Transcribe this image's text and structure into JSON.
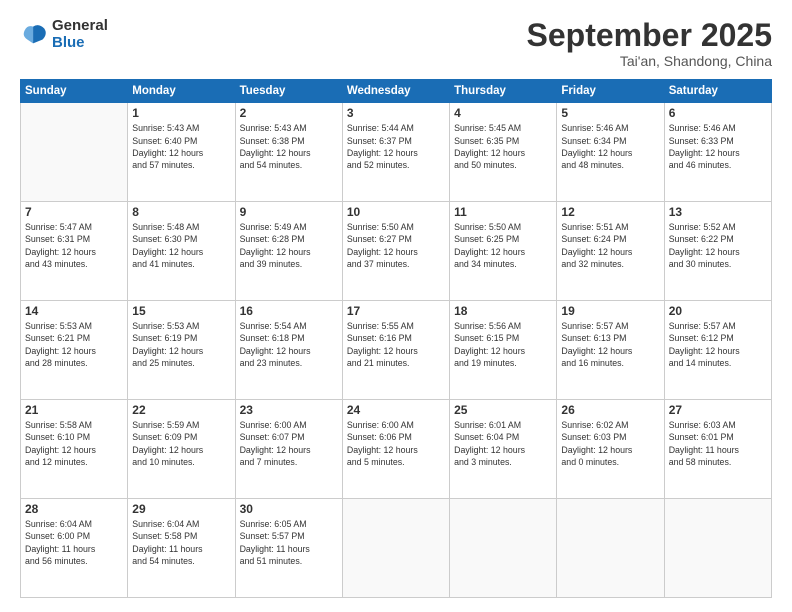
{
  "header": {
    "logo_line1": "General",
    "logo_line2": "Blue",
    "month": "September 2025",
    "location": "Tai'an, Shandong, China"
  },
  "days_of_week": [
    "Sunday",
    "Monday",
    "Tuesday",
    "Wednesday",
    "Thursday",
    "Friday",
    "Saturday"
  ],
  "weeks": [
    [
      {
        "day": "",
        "info": ""
      },
      {
        "day": "1",
        "info": "Sunrise: 5:43 AM\nSunset: 6:40 PM\nDaylight: 12 hours\nand 57 minutes."
      },
      {
        "day": "2",
        "info": "Sunrise: 5:43 AM\nSunset: 6:38 PM\nDaylight: 12 hours\nand 54 minutes."
      },
      {
        "day": "3",
        "info": "Sunrise: 5:44 AM\nSunset: 6:37 PM\nDaylight: 12 hours\nand 52 minutes."
      },
      {
        "day": "4",
        "info": "Sunrise: 5:45 AM\nSunset: 6:35 PM\nDaylight: 12 hours\nand 50 minutes."
      },
      {
        "day": "5",
        "info": "Sunrise: 5:46 AM\nSunset: 6:34 PM\nDaylight: 12 hours\nand 48 minutes."
      },
      {
        "day": "6",
        "info": "Sunrise: 5:46 AM\nSunset: 6:33 PM\nDaylight: 12 hours\nand 46 minutes."
      }
    ],
    [
      {
        "day": "7",
        "info": "Sunrise: 5:47 AM\nSunset: 6:31 PM\nDaylight: 12 hours\nand 43 minutes."
      },
      {
        "day": "8",
        "info": "Sunrise: 5:48 AM\nSunset: 6:30 PM\nDaylight: 12 hours\nand 41 minutes."
      },
      {
        "day": "9",
        "info": "Sunrise: 5:49 AM\nSunset: 6:28 PM\nDaylight: 12 hours\nand 39 minutes."
      },
      {
        "day": "10",
        "info": "Sunrise: 5:50 AM\nSunset: 6:27 PM\nDaylight: 12 hours\nand 37 minutes."
      },
      {
        "day": "11",
        "info": "Sunrise: 5:50 AM\nSunset: 6:25 PM\nDaylight: 12 hours\nand 34 minutes."
      },
      {
        "day": "12",
        "info": "Sunrise: 5:51 AM\nSunset: 6:24 PM\nDaylight: 12 hours\nand 32 minutes."
      },
      {
        "day": "13",
        "info": "Sunrise: 5:52 AM\nSunset: 6:22 PM\nDaylight: 12 hours\nand 30 minutes."
      }
    ],
    [
      {
        "day": "14",
        "info": "Sunrise: 5:53 AM\nSunset: 6:21 PM\nDaylight: 12 hours\nand 28 minutes."
      },
      {
        "day": "15",
        "info": "Sunrise: 5:53 AM\nSunset: 6:19 PM\nDaylight: 12 hours\nand 25 minutes."
      },
      {
        "day": "16",
        "info": "Sunrise: 5:54 AM\nSunset: 6:18 PM\nDaylight: 12 hours\nand 23 minutes."
      },
      {
        "day": "17",
        "info": "Sunrise: 5:55 AM\nSunset: 6:16 PM\nDaylight: 12 hours\nand 21 minutes."
      },
      {
        "day": "18",
        "info": "Sunrise: 5:56 AM\nSunset: 6:15 PM\nDaylight: 12 hours\nand 19 minutes."
      },
      {
        "day": "19",
        "info": "Sunrise: 5:57 AM\nSunset: 6:13 PM\nDaylight: 12 hours\nand 16 minutes."
      },
      {
        "day": "20",
        "info": "Sunrise: 5:57 AM\nSunset: 6:12 PM\nDaylight: 12 hours\nand 14 minutes."
      }
    ],
    [
      {
        "day": "21",
        "info": "Sunrise: 5:58 AM\nSunset: 6:10 PM\nDaylight: 12 hours\nand 12 minutes."
      },
      {
        "day": "22",
        "info": "Sunrise: 5:59 AM\nSunset: 6:09 PM\nDaylight: 12 hours\nand 10 minutes."
      },
      {
        "day": "23",
        "info": "Sunrise: 6:00 AM\nSunset: 6:07 PM\nDaylight: 12 hours\nand 7 minutes."
      },
      {
        "day": "24",
        "info": "Sunrise: 6:00 AM\nSunset: 6:06 PM\nDaylight: 12 hours\nand 5 minutes."
      },
      {
        "day": "25",
        "info": "Sunrise: 6:01 AM\nSunset: 6:04 PM\nDaylight: 12 hours\nand 3 minutes."
      },
      {
        "day": "26",
        "info": "Sunrise: 6:02 AM\nSunset: 6:03 PM\nDaylight: 12 hours\nand 0 minutes."
      },
      {
        "day": "27",
        "info": "Sunrise: 6:03 AM\nSunset: 6:01 PM\nDaylight: 11 hours\nand 58 minutes."
      }
    ],
    [
      {
        "day": "28",
        "info": "Sunrise: 6:04 AM\nSunset: 6:00 PM\nDaylight: 11 hours\nand 56 minutes."
      },
      {
        "day": "29",
        "info": "Sunrise: 6:04 AM\nSunset: 5:58 PM\nDaylight: 11 hours\nand 54 minutes."
      },
      {
        "day": "30",
        "info": "Sunrise: 6:05 AM\nSunset: 5:57 PM\nDaylight: 11 hours\nand 51 minutes."
      },
      {
        "day": "",
        "info": ""
      },
      {
        "day": "",
        "info": ""
      },
      {
        "day": "",
        "info": ""
      },
      {
        "day": "",
        "info": ""
      }
    ]
  ]
}
